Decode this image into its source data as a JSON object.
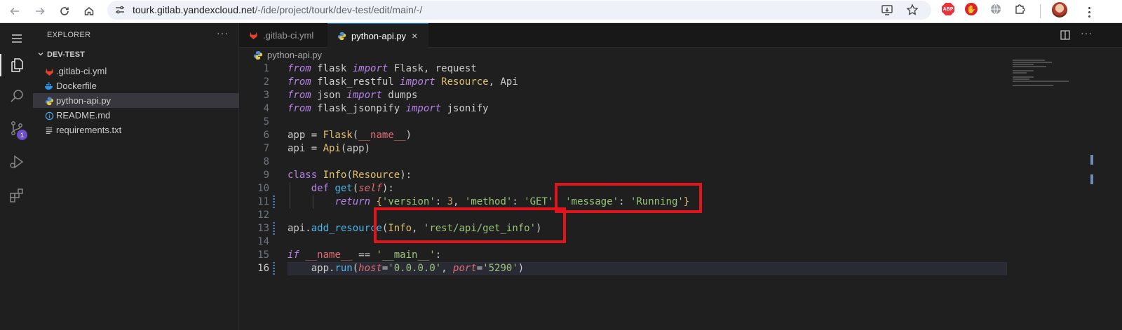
{
  "browser": {
    "url_host": "tourk.gitlab.yandexcloud.net",
    "url_path": "/-/ide/project/tourk/dev-test/edit/main/-/",
    "ext_abp": "ABP",
    "ext_hand": "✋"
  },
  "activity_bar": {
    "items": [
      "menu-icon",
      "explorer-icon",
      "search-icon",
      "source-control-icon",
      "run-debug-icon",
      "extensions-icon"
    ],
    "scm_badge": "1"
  },
  "explorer": {
    "title": "EXPLORER",
    "more": "···",
    "root": "DEV-TEST",
    "files": [
      {
        "name": ".gitlab-ci.yml",
        "icon": "gitlab-icon"
      },
      {
        "name": "Dockerfile",
        "icon": "docker-icon"
      },
      {
        "name": "python-api.py",
        "icon": "python-icon",
        "selected": true
      },
      {
        "name": "README.md",
        "icon": "info-icon"
      },
      {
        "name": "requirements.txt",
        "icon": "text-file-icon"
      }
    ]
  },
  "tabs": [
    {
      "label": ".gitlab-ci.yml",
      "active": false
    },
    {
      "label": "python-api.py",
      "active": true,
      "close": "×"
    }
  ],
  "breadcrumb": "python-api.py",
  "tab_more": "···",
  "code": {
    "current_line": 16,
    "line_numbers": [
      "1",
      "2",
      "3",
      "4",
      "5",
      "6",
      "7",
      "8",
      "9",
      "10",
      "11",
      "12",
      "13",
      "14",
      "15",
      "16"
    ],
    "lines": [
      "from flask import Flask, request",
      "from flask_restful import Resource, Api",
      "from json import dumps",
      "from flask_jsonpify import jsonify",
      "",
      "app = Flask(__name__)",
      "api = Api(app)",
      "",
      "class Info(Resource):",
      "    def get(self):",
      "        return {'version': 3, 'method': 'GET', 'message': 'Running'}",
      "",
      "api.add_resource(Info, 'rest/api/get_info')",
      "",
      "if __name__ == '__main__':",
      "    app.run(host='0.0.0.0', port='5290')"
    ]
  },
  "colors": {
    "highlight_box": "#e0141a",
    "accent": "#0078d4"
  }
}
